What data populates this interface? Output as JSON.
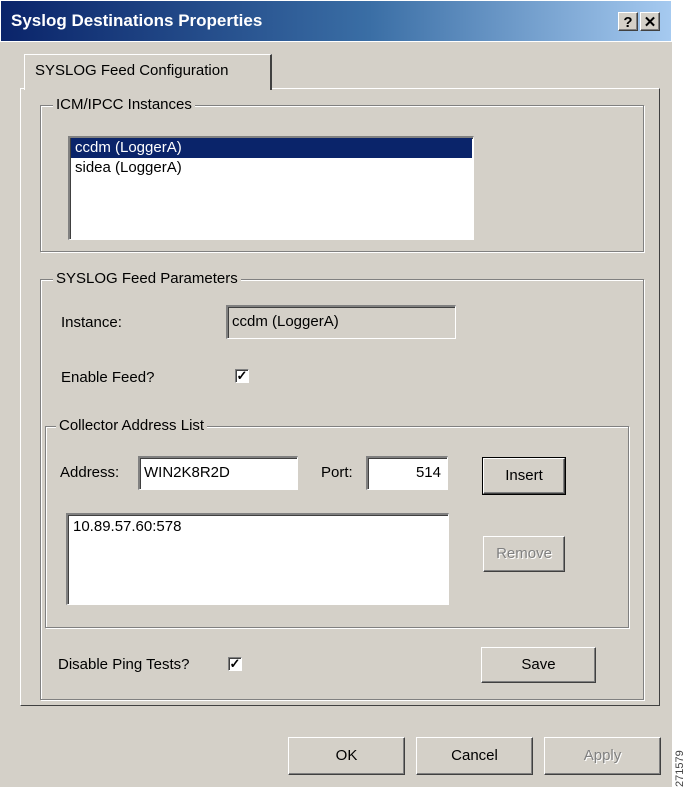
{
  "window": {
    "title": "Syslog Destinations Properties",
    "help_button": "?",
    "close_button": "✕"
  },
  "tabs": [
    {
      "label": "SYSLOG Feed Configuration",
      "active": true
    }
  ],
  "instances_group": {
    "label": "ICM/IPCC Instances",
    "items": [
      "ccdm (LoggerA)",
      "sidea (LoggerA)"
    ],
    "selected_index": 0
  },
  "params_group": {
    "label": "SYSLOG Feed Parameters",
    "instance_label": "Instance:",
    "instance_value": "ccdm (LoggerA)",
    "enable_feed_label": "Enable Feed?",
    "enable_feed_checked": true,
    "check_mark": "✓"
  },
  "collector_group": {
    "label": "Collector Address List",
    "address_label": "Address:",
    "address_value": "WIN2K8R2D",
    "port_label": "Port:",
    "port_value": "514",
    "insert_button": "Insert",
    "remove_button": "Remove",
    "addresses": [
      "10.89.57.60:578"
    ]
  },
  "ping": {
    "label": "Disable Ping Tests?",
    "checked": true
  },
  "save_button": "Save",
  "footer": {
    "ok_button": "OK",
    "cancel_button": "Cancel",
    "apply_button": "Apply"
  },
  "side_code": "271579"
}
